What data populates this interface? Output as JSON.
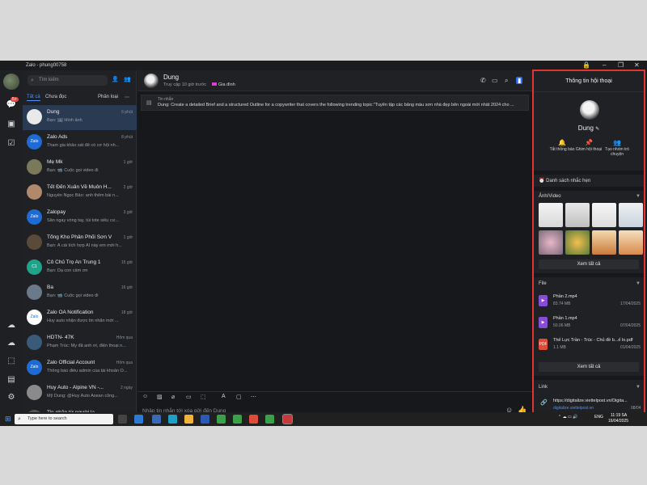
{
  "window": {
    "title": "Zalo - phung00758"
  },
  "rail": {
    "badge": "5+"
  },
  "search": {
    "placeholder": "Tìm kiếm"
  },
  "tabs": {
    "all": "Tất cả",
    "unread": "Chưa đọc",
    "classify": "Phân loại"
  },
  "conversations": [
    {
      "name": "Dung",
      "time": "6 phút",
      "msg": "Bạn: 🖼 Hình ảnh",
      "avatar": "",
      "color": "#e9e9e9"
    },
    {
      "name": "Zalo Ads",
      "time": "8 phút",
      "msg": "Tham gia khảo sát để có cơ hội nh...",
      "avatar": "Zalo Ads",
      "color": "#1e6bd6"
    },
    {
      "name": "Mẹ Mk",
      "time": "1 giờ",
      "msg": "Bạn: 📹 Cuộc gọi video đi",
      "avatar": "",
      "color": "#7a7a5a"
    },
    {
      "name": "Tết Đến Xuân Về Muôn H...",
      "time": "2 giờ",
      "msg": "Nguyễn Ngọc Bảo: anh thêm bài n...",
      "avatar": "",
      "color": "#b0886a"
    },
    {
      "name": "Zalopay",
      "time": "3 giờ",
      "msg": "Săn ngay vòng tay, túi tote siêu cư...",
      "avatar": "Zalo pay",
      "color": "#1e6bd6"
    },
    {
      "name": "Tổng Kho Phân Phối Sơn Vă...",
      "time": "1 giờ",
      "msg": "Bạn: Ả cái tích hợp AI này em mới h...",
      "avatar": "",
      "color": "#5a4a3a"
    },
    {
      "name": "Cô Chủ Trọ An Trung 1",
      "time": "15 giờ",
      "msg": "Bạn: Dạ con cảm ơn",
      "avatar": "C1",
      "color": "#1fa38a"
    },
    {
      "name": "Ba",
      "time": "16 giờ",
      "msg": "Bạn: 📹 Cuộc gọi video đi",
      "avatar": "",
      "color": "#6a7a8a"
    },
    {
      "name": "Zalo OA Notification",
      "time": "18 giờ",
      "msg": "Huy auto nhận được tin nhắn mới ...",
      "avatar": "Zalo",
      "color": "#ffffff"
    },
    {
      "name": "HDTN- 47K",
      "time": "Hôm qua",
      "msg": "Phạm Trúc: My đã anh ơi, điện thoại n...",
      "avatar": "",
      "color": "#3a5a7a"
    },
    {
      "name": "Zalo Official Account",
      "time": "Hôm qua",
      "msg": "Thông báo điều admin của tài khoản O...",
      "avatar": "Zalo",
      "color": "#1e6bd6"
    },
    {
      "name": "Huy Auto - Alpine VN -...",
      "time": "2 ngày",
      "msg": "Mỹ Dung: @Huy Auto Asean công...",
      "avatar": "",
      "color": "#8a8a8a"
    },
    {
      "name": "Tin nhắn từ người lạ",
      "time": "",
      "msg": "",
      "avatar": "",
      "color": "#555555"
    }
  ],
  "chat": {
    "name": "Dung",
    "status": "Truy cập 10 giờ trước",
    "tag": "Gia đình",
    "pinned_title": "Tin nhắn",
    "pinned_text": "Dung: Create a detailed Brief and a structured Outline for a copywriter that covers the following trending topic:\"Tuyển tập các bảng màu sơn nhà đẹp bên ngoài mới nhất 2024 cho ...",
    "compose_placeholder": "Nhập tin nhắn tới xóa gửi đến Dung"
  },
  "info": {
    "title": "Thông tin hội thoại",
    "name": "Dung",
    "actions": [
      "Tắt thông báo",
      "Ghim hội thoại",
      "Tạo nhóm trò chuyện"
    ],
    "reminders": "Danh sách nhắc hẹn",
    "media_title": "Ảnh/Video",
    "view_all": "Xem tất cả",
    "file_title": "File",
    "files": [
      {
        "name": "Phần 2.mp4",
        "size": "83.74 MB",
        "date": "17/04/2025",
        "type": "video",
        "color": "#8a4bd6"
      },
      {
        "name": "Phần 1.mp4",
        "size": "50.06 MB",
        "date": "07/04/2025",
        "type": "video",
        "color": "#8a4bd6"
      },
      {
        "name": "Thế Lực Trần - Trúc - Chủ đề b...ế lo.pdf",
        "size": "1.1 MB",
        "date": "01/04/2025",
        "type": "PDF",
        "color": "#e04a3a"
      }
    ],
    "link_title": "Link",
    "link_url": "https://digitalize.viettelpost.vn/Digita...",
    "link_domain": "digitalize.viettelpost.vn",
    "link_date": "08/04"
  },
  "taskbar": {
    "search_placeholder": "Type here to search",
    "lang": "ENG",
    "time": "11:19 SA",
    "date": "16/04/2025"
  }
}
